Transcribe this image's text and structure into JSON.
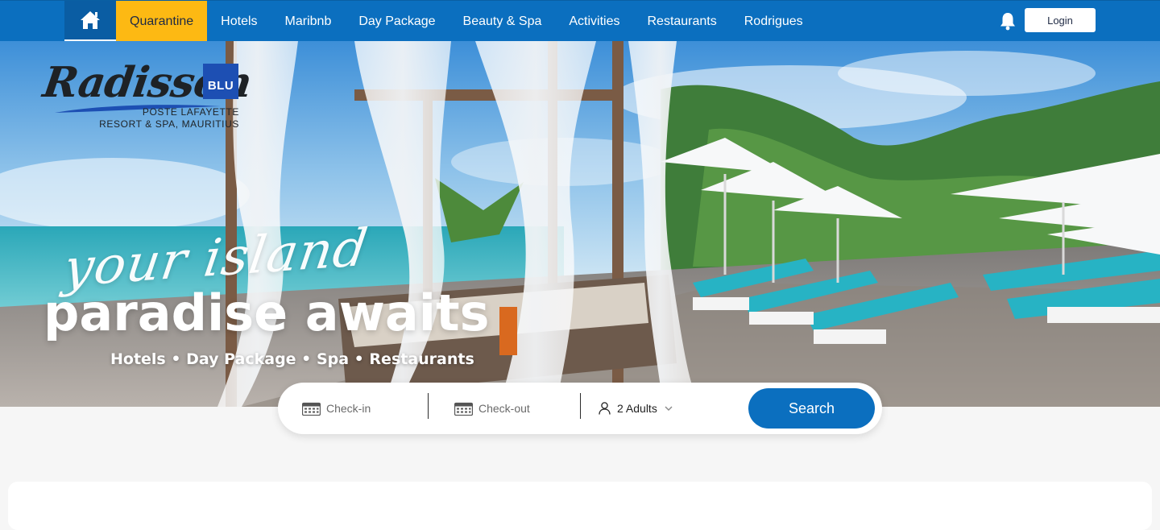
{
  "nav": {
    "home_icon": "home-icon",
    "items": [
      {
        "label": "Quarantine",
        "active": true
      },
      {
        "label": "Hotels"
      },
      {
        "label": "Maribnb"
      },
      {
        "label": "Day Package"
      },
      {
        "label": "Beauty & Spa"
      },
      {
        "label": "Activities"
      },
      {
        "label": "Restaurants"
      },
      {
        "label": "Rodrigues"
      }
    ],
    "bell_icon": "bell-icon",
    "login_label": "Login"
  },
  "brand": {
    "script": "Radisson",
    "badge": "BLU",
    "line1": "POSTE LAFAYETTE",
    "line2": "RESORT & SPA, MAURITIUS"
  },
  "hero": {
    "script_line": "your island",
    "headline": "paradise awaits",
    "subline": "Hotels • Day Package • Spa • Restaurants"
  },
  "search": {
    "checkin_placeholder": "Check-in",
    "checkout_placeholder": "Check-out",
    "guests_value": "2 Adults",
    "button_label": "Search",
    "calendar_icon": "calendar-icon",
    "user_icon": "user-icon",
    "chevron_icon": "chevron-down-icon"
  },
  "colors": {
    "primary": "#0b6fbf",
    "accent": "#fdb913",
    "page_bg": "#f6f6f6"
  }
}
